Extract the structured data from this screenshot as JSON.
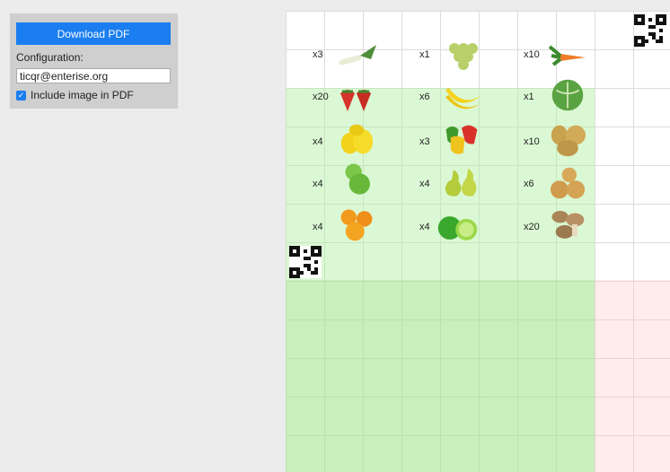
{
  "panel": {
    "download_label": "Download PDF",
    "config_label": "Configuration:",
    "config_value": "ticqr@enterise.org",
    "include_image_label": "Include image in PDF",
    "include_image_checked": true
  },
  "grid": {
    "rows": [
      [
        {
          "qty": "x3",
          "item": "leek-icon"
        },
        {
          "qty": "x1",
          "item": "grapes-icon"
        },
        {
          "qty": "x10",
          "item": "carrot-icon"
        }
      ],
      [
        {
          "qty": "x20",
          "item": "strawberry-icon"
        },
        {
          "qty": "x6",
          "item": "banana-icon"
        },
        {
          "qty": "x1",
          "item": "cabbage-icon"
        }
      ],
      [
        {
          "qty": "x4",
          "item": "lemon-icon"
        },
        {
          "qty": "x3",
          "item": "pepper-icon"
        },
        {
          "qty": "x10",
          "item": "potato-icon"
        }
      ],
      [
        {
          "qty": "x4",
          "item": "green-apple-icon"
        },
        {
          "qty": "x4",
          "item": "pear-icon"
        },
        {
          "qty": "x6",
          "item": "onion-icon"
        }
      ],
      [
        {
          "qty": "x4",
          "item": "orange-icon"
        },
        {
          "qty": "x4",
          "item": "lime-icon"
        },
        {
          "qty": "x20",
          "item": "mushroom-icon"
        }
      ]
    ]
  },
  "colors": {
    "accent": "#1a7ef0",
    "green_zone": "#d6f5cc",
    "red_zone": "#fde6e6"
  }
}
